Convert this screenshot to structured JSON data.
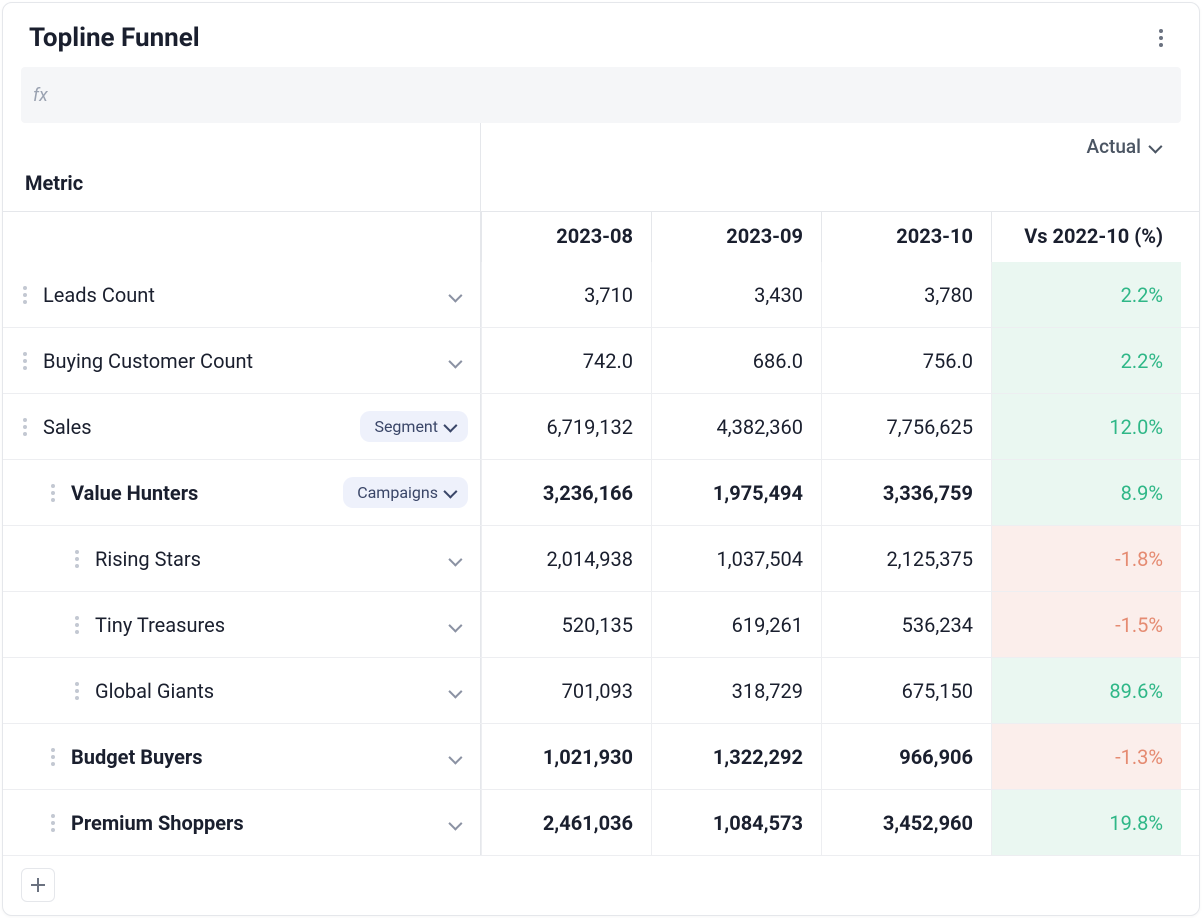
{
  "header": {
    "title": "Topline Funnel",
    "fx_label": "fx"
  },
  "columns": {
    "metric_label": "Metric",
    "actual_label": "Actual",
    "periods": [
      "2023-08",
      "2023-09",
      "2023-10"
    ],
    "comparison": "Vs 2022-10 (%)"
  },
  "pills": {
    "segment": "Segment",
    "campaigns": "Campaigns"
  },
  "rows": [
    {
      "id": "leads",
      "label": "Leads Count",
      "indent": 0,
      "bold": false,
      "pill": null,
      "v1": "3,710",
      "v2": "3,430",
      "v3": "3,780",
      "pct": "2.2%",
      "pct_sign": "pos"
    },
    {
      "id": "buying-customers",
      "label": "Buying Customer Count",
      "indent": 0,
      "bold": false,
      "pill": null,
      "v1": "742.0",
      "v2": "686.0",
      "v3": "756.0",
      "pct": "2.2%",
      "pct_sign": "pos"
    },
    {
      "id": "sales",
      "label": "Sales",
      "indent": 0,
      "bold": false,
      "pill": "segment",
      "v1": "6,719,132",
      "v2": "4,382,360",
      "v3": "7,756,625",
      "pct": "12.0%",
      "pct_sign": "pos"
    },
    {
      "id": "value-hunters",
      "label": "Value Hunters",
      "indent": 1,
      "bold": true,
      "pill": "campaigns",
      "v1": "3,236,166",
      "v2": "1,975,494",
      "v3": "3,336,759",
      "pct": "8.9%",
      "pct_sign": "pos"
    },
    {
      "id": "rising-stars",
      "label": "Rising Stars",
      "indent": 2,
      "bold": false,
      "pill": null,
      "v1": "2,014,938",
      "v2": "1,037,504",
      "v3": "2,125,375",
      "pct": "-1.8%",
      "pct_sign": "neg"
    },
    {
      "id": "tiny-treasures",
      "label": "Tiny Treasures",
      "indent": 2,
      "bold": false,
      "pill": null,
      "v1": "520,135",
      "v2": "619,261",
      "v3": "536,234",
      "pct": "-1.5%",
      "pct_sign": "neg"
    },
    {
      "id": "global-giants",
      "label": "Global Giants",
      "indent": 2,
      "bold": false,
      "pill": null,
      "v1": "701,093",
      "v2": "318,729",
      "v3": "675,150",
      "pct": "89.6%",
      "pct_sign": "pos"
    },
    {
      "id": "budget-buyers",
      "label": "Budget Buyers",
      "indent": 1,
      "bold": true,
      "pill": null,
      "v1": "1,021,930",
      "v2": "1,322,292",
      "v3": "966,906",
      "pct": "-1.3%",
      "pct_sign": "neg"
    },
    {
      "id": "premium-shoppers",
      "label": "Premium Shoppers",
      "indent": 1,
      "bold": true,
      "pill": null,
      "v1": "2,461,036",
      "v2": "1,084,573",
      "v3": "3,452,960",
      "pct": "19.8%",
      "pct_sign": "pos"
    }
  ]
}
